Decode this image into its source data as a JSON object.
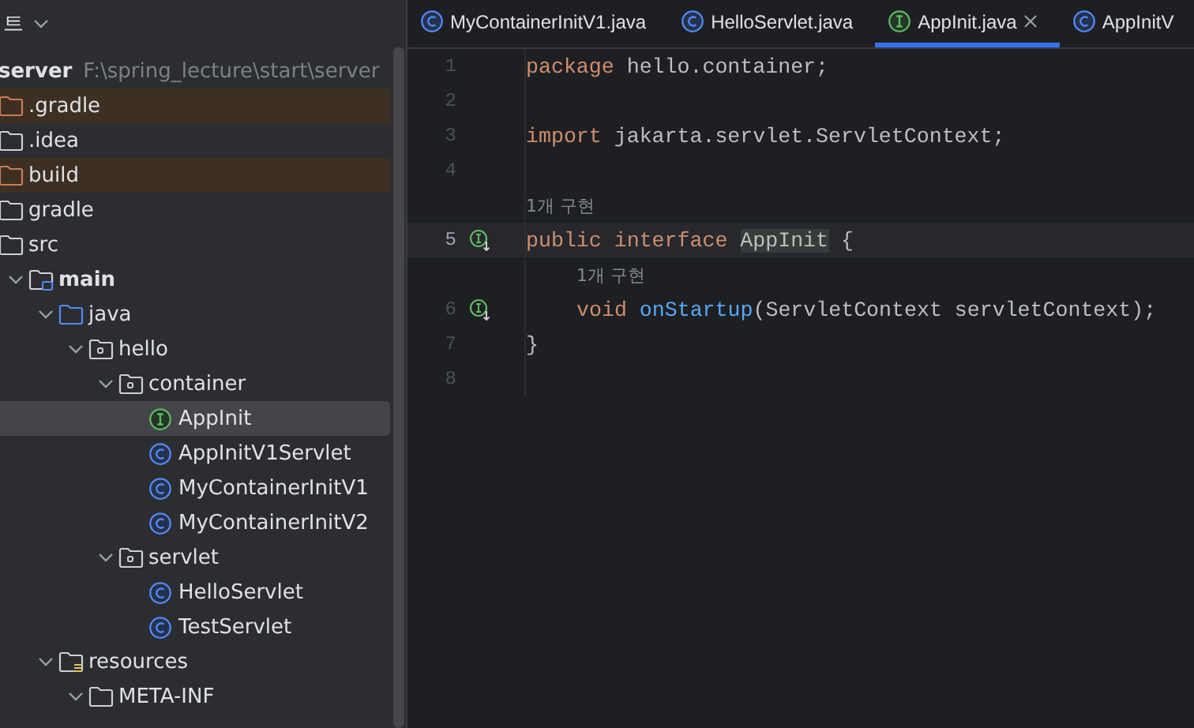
{
  "project_view": {
    "title": "트",
    "tree": {
      "label": "server",
      "path": "F:\\spring_lecture\\start\\server",
      "kind": "module",
      "selected": false,
      "children": [
        {
          "label": ".gradle",
          "kind": "excluded-folder",
          "selected": false
        },
        {
          "label": ".idea",
          "kind": "folder",
          "selected": false
        },
        {
          "label": "build",
          "kind": "excluded-folder",
          "selected": false
        },
        {
          "label": "gradle",
          "kind": "folder",
          "selected": false
        },
        {
          "label": "src",
          "kind": "folder",
          "selected": false,
          "children": [
            {
              "label": "main",
              "kind": "source-set",
              "expanded": true,
              "selected": false,
              "children": [
                {
                  "label": "java",
                  "kind": "source-root",
                  "expanded": true,
                  "selected": false,
                  "children": [
                    {
                      "label": "hello",
                      "kind": "package",
                      "expanded": true,
                      "selected": false,
                      "children": [
                        {
                          "label": "container",
                          "kind": "package",
                          "expanded": true,
                          "selected": false,
                          "children": [
                            {
                              "label": "AppInit",
                              "kind": "interface",
                              "selected": true
                            },
                            {
                              "label": "AppInitV1Servlet",
                              "kind": "class",
                              "selected": false
                            },
                            {
                              "label": "MyContainerInitV1",
                              "kind": "class",
                              "selected": false
                            },
                            {
                              "label": "MyContainerInitV2",
                              "kind": "class",
                              "selected": false
                            }
                          ]
                        },
                        {
                          "label": "servlet",
                          "kind": "package",
                          "expanded": true,
                          "selected": false,
                          "children": [
                            {
                              "label": "HelloServlet",
                              "kind": "class",
                              "selected": false
                            },
                            {
                              "label": "TestServlet",
                              "kind": "class",
                              "selected": false
                            }
                          ]
                        }
                      ]
                    }
                  ]
                },
                {
                  "label": "resources",
                  "kind": "resources-root",
                  "expanded": true,
                  "selected": false,
                  "children": [
                    {
                      "label": "META-INF",
                      "kind": "folder",
                      "expanded": true,
                      "selected": false
                    }
                  ]
                }
              ]
            }
          ]
        }
      ]
    }
  },
  "editor": {
    "tabs": [
      {
        "label": "MyContainerInitV1.java",
        "kind": "class",
        "selected": false
      },
      {
        "label": "HelloServlet.java",
        "kind": "class",
        "selected": false
      },
      {
        "label": "AppInit.java",
        "kind": "interface",
        "selected": true
      },
      {
        "label": "AppInitV",
        "kind": "class",
        "selected": false
      }
    ],
    "lines": [
      {
        "number": "1",
        "current": false,
        "implemented": false,
        "tokens": [
          {
            "text": "package ",
            "kind": "keyword"
          },
          {
            "text": "hello.container;",
            "kind": "plain"
          }
        ]
      },
      {
        "number": "2",
        "current": false,
        "implemented": false
      },
      {
        "number": "3",
        "current": false,
        "implemented": false,
        "tokens": [
          {
            "text": "import ",
            "kind": "keyword"
          },
          {
            "text": "jakarta.servlet.ServletContext;",
            "kind": "plain"
          }
        ]
      },
      {
        "number": "4",
        "current": false,
        "implemented": false
      },
      {
        "number": "5",
        "current": true,
        "hint": "1개 구현",
        "implemented": true,
        "tokens": [
          {
            "text": "public interface ",
            "kind": "keyword"
          },
          {
            "text": "AppInit",
            "kind": "usage"
          },
          {
            "text": " {",
            "kind": "plain"
          }
        ]
      },
      {
        "number": "6",
        "current": false,
        "hint": "1개 구현",
        "indent": true,
        "implemented": true,
        "tokens": [
          {
            "text": "void ",
            "kind": "keyword"
          },
          {
            "text": "onStartup",
            "kind": "function"
          },
          {
            "text": "(ServletContext servletContext);",
            "kind": "plain"
          }
        ]
      },
      {
        "number": "7",
        "current": false,
        "implemented": false,
        "tokens": [
          {
            "text": "}",
            "kind": "plain"
          }
        ]
      },
      {
        "number": "8",
        "current": false,
        "implemented": false
      }
    ]
  }
}
